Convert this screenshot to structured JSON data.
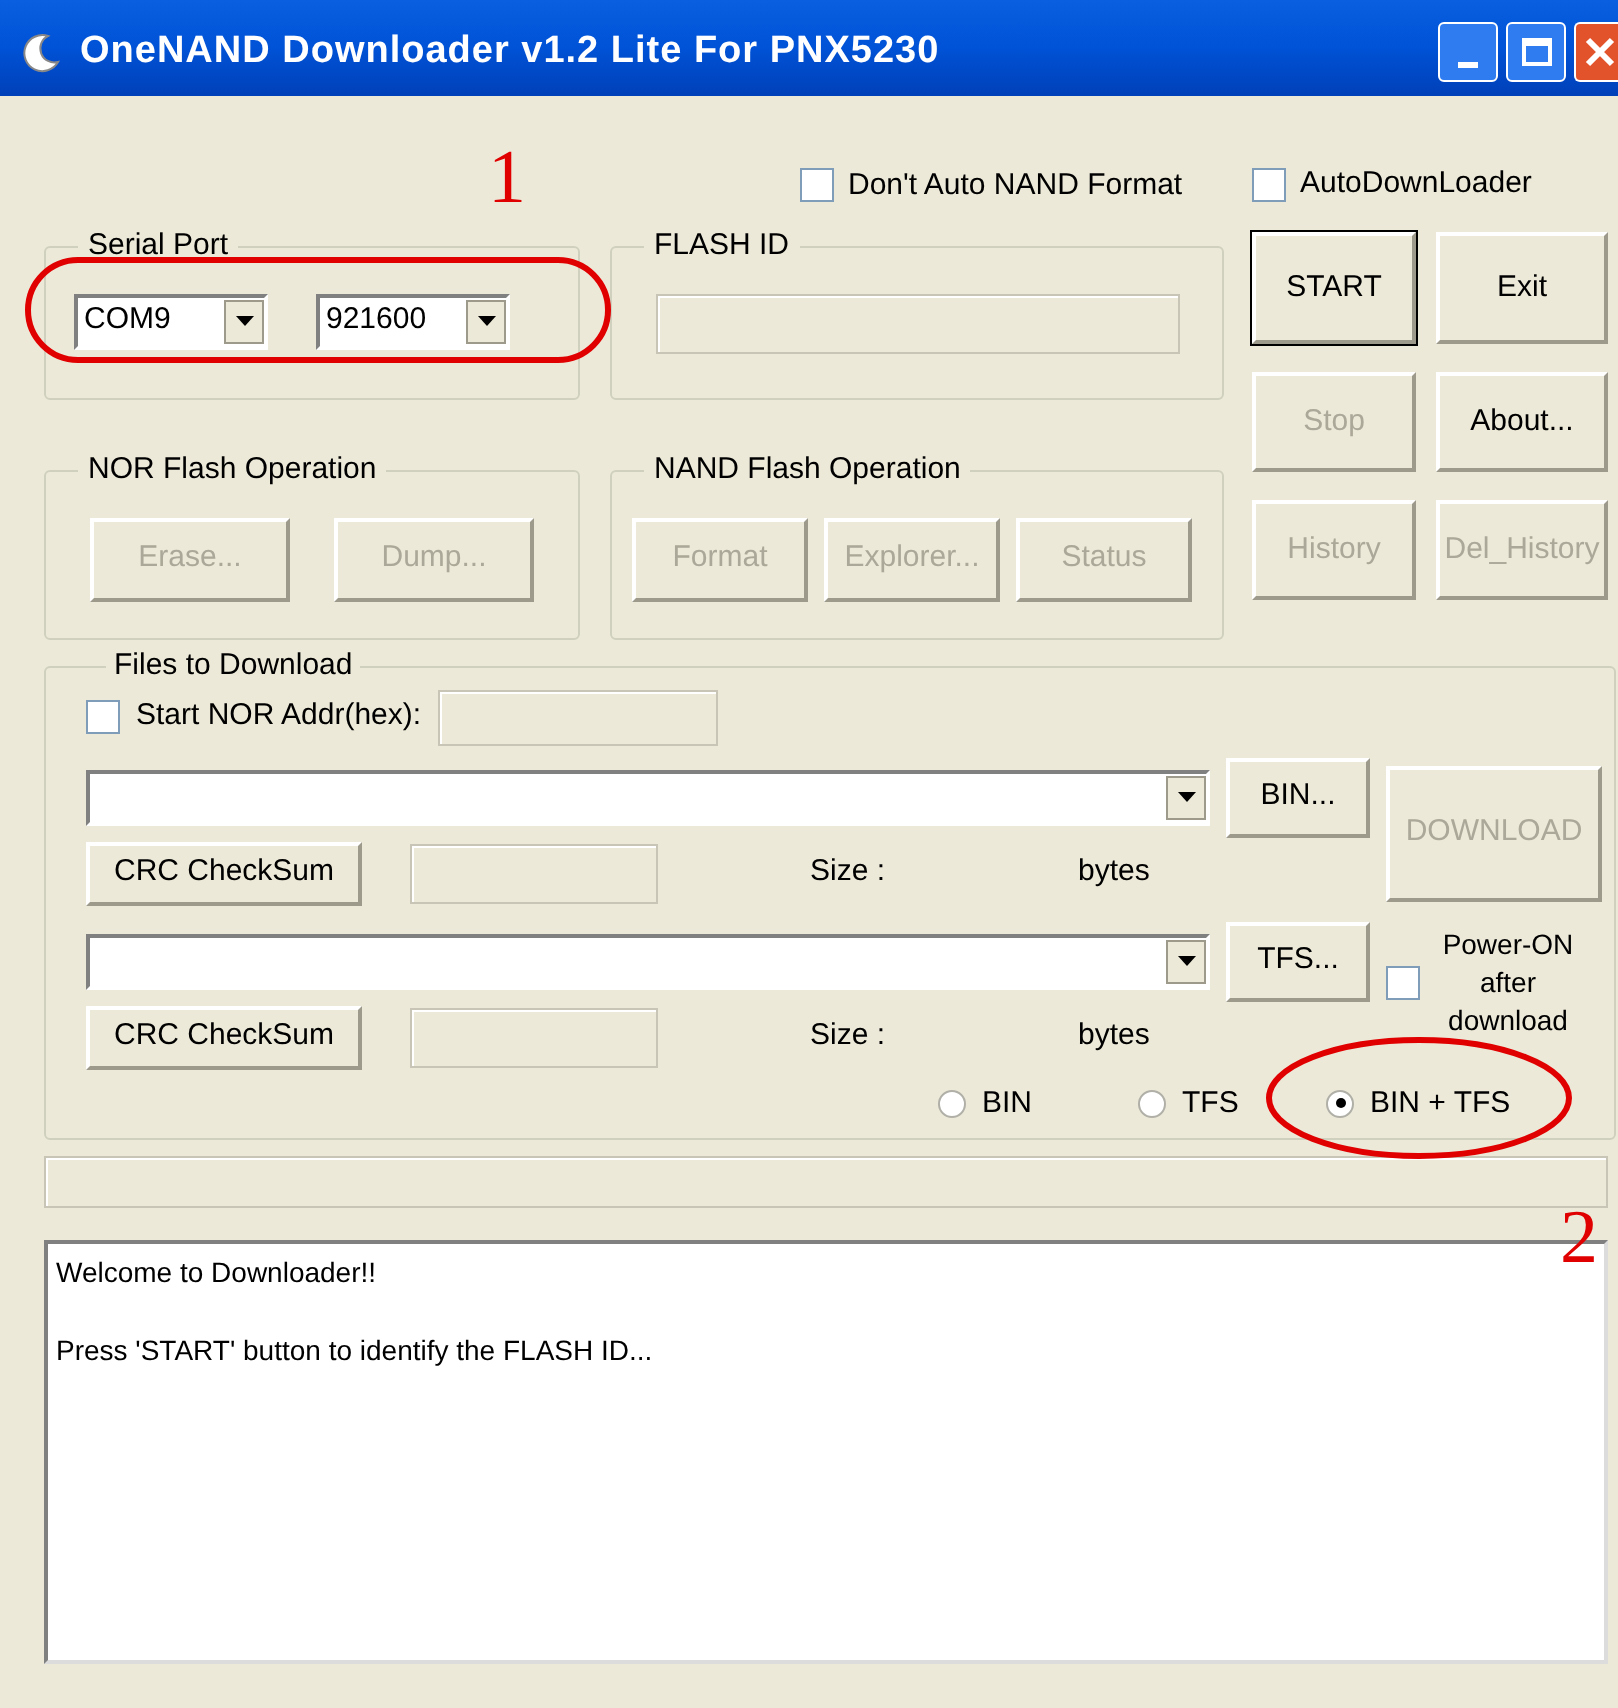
{
  "window": {
    "title": "OneNAND Downloader v1.2 Lite For PNX5230"
  },
  "options": [
    {
      "label": "Don't Auto NAND Format",
      "checked": false
    },
    {
      "label": "AutoDownLoader",
      "checked": false
    }
  ],
  "serial_port": {
    "title": "Serial Port",
    "port": "COM9",
    "baud": "921600"
  },
  "flash_id": {
    "title": "FLASH ID"
  },
  "main_buttons": [
    {
      "label": "START",
      "disabled": false,
      "default": true
    },
    {
      "label": "Exit",
      "disabled": false,
      "default": false
    },
    {
      "label": "Stop",
      "disabled": true,
      "default": false
    },
    {
      "label": "About...",
      "disabled": false,
      "default": false
    },
    {
      "label": "History",
      "disabled": true,
      "default": false
    },
    {
      "label": "Del_History",
      "disabled": true,
      "default": false
    }
  ],
  "nor": {
    "title": "NOR Flash Operation",
    "buttons": [
      {
        "label": "Erase...",
        "disabled": true
      },
      {
        "label": "Dump...",
        "disabled": true
      }
    ]
  },
  "nand": {
    "title": "NAND Flash Operation",
    "buttons": [
      {
        "label": "Format",
        "disabled": true
      },
      {
        "label": "Explorer...",
        "disabled": true
      },
      {
        "label": "Status",
        "disabled": true
      }
    ]
  },
  "files": {
    "title": "Files to Download",
    "nor_addr": {
      "label": "Start NOR Addr(hex):",
      "checked": false
    },
    "rows": [
      {
        "browse": "BIN...",
        "crc": "CRC CheckSum",
        "size_label": "Size :",
        "unit": "bytes"
      },
      {
        "browse": "TFS...",
        "crc": "CRC CheckSum",
        "size_label": "Size :",
        "unit": "bytes"
      }
    ],
    "download": {
      "label": "DOWNLOAD",
      "disabled": true
    },
    "power_on": {
      "label": "Power-ON after download",
      "checked": false
    },
    "modes": [
      {
        "label": "BIN",
        "selected": false
      },
      {
        "label": "TFS",
        "selected": false
      },
      {
        "label": "BIN + TFS",
        "selected": true
      }
    ]
  },
  "progress": {
    "level": 0
  },
  "log": {
    "lines": [
      "Welcome to Downloader!!",
      "Press 'START' button to identify the FLASH ID..."
    ]
  },
  "annotations": [
    {
      "label": "1"
    },
    {
      "label": "2"
    }
  ]
}
